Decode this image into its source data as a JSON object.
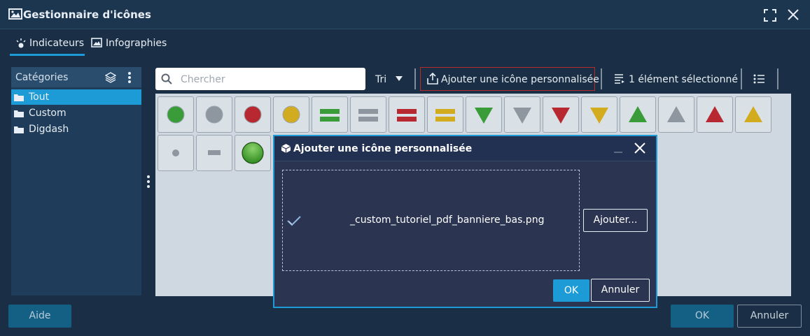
{
  "window": {
    "title": "Gestionnaire d'icônes"
  },
  "tabs": [
    {
      "label": "Indicateurs",
      "active": true
    },
    {
      "label": "Infographies",
      "active": false
    }
  ],
  "categories": {
    "title": "Catégories",
    "items": [
      {
        "label": "Tout",
        "selected": true
      },
      {
        "label": "Custom",
        "selected": false
      },
      {
        "label": "Digdash",
        "selected": false
      }
    ]
  },
  "toolbar": {
    "search_placeholder": "Chercher",
    "sort_label": "Tri",
    "add_custom_label": "Ajouter une icône personnalisée",
    "selected_label": "1 élément sélectionné"
  },
  "icons": [
    {
      "shape": "circle",
      "color": "#3a9c38"
    },
    {
      "shape": "circle",
      "color": "#8e979f"
    },
    {
      "shape": "circle",
      "color": "#b82830"
    },
    {
      "shape": "circle",
      "color": "#d2ac1e"
    },
    {
      "shape": "bars",
      "color": "#3a9c38"
    },
    {
      "shape": "bars",
      "color": "#8e979f"
    },
    {
      "shape": "bars",
      "color": "#b82830"
    },
    {
      "shape": "bars",
      "color": "#d2ac1e"
    },
    {
      "shape": "triangle-down",
      "color": "#3a9c38"
    },
    {
      "shape": "triangle-down",
      "color": "#8e979f"
    },
    {
      "shape": "triangle-down",
      "color": "#b82830"
    },
    {
      "shape": "triangle-down",
      "color": "#d2ac1e"
    },
    {
      "shape": "triangle-up",
      "color": "#3a9c38"
    },
    {
      "shape": "triangle-up",
      "color": "#8e979f"
    },
    {
      "shape": "triangle-up",
      "color": "#b82830"
    },
    {
      "shape": "triangle-up",
      "color": "#d2ac1e"
    },
    {
      "shape": "dot",
      "color": "#8e979f"
    },
    {
      "shape": "dash",
      "color": "#8e979f"
    },
    {
      "shape": "glossy-circle",
      "color": "#2e8a1f"
    }
  ],
  "footer": {
    "help_label": "Aide",
    "ok_label": "OK",
    "cancel_label": "Annuler"
  },
  "dialog": {
    "title": "Ajouter une icône personnalisée",
    "file_name": "_custom_tutoriel_pdf_banniere_bas.png",
    "add_button_label": "Ajouter...",
    "ok_label": "OK",
    "cancel_label": "Annuler"
  },
  "colors": {
    "accent": "#1c9bd6",
    "highlight_border": "#b92a2a"
  }
}
